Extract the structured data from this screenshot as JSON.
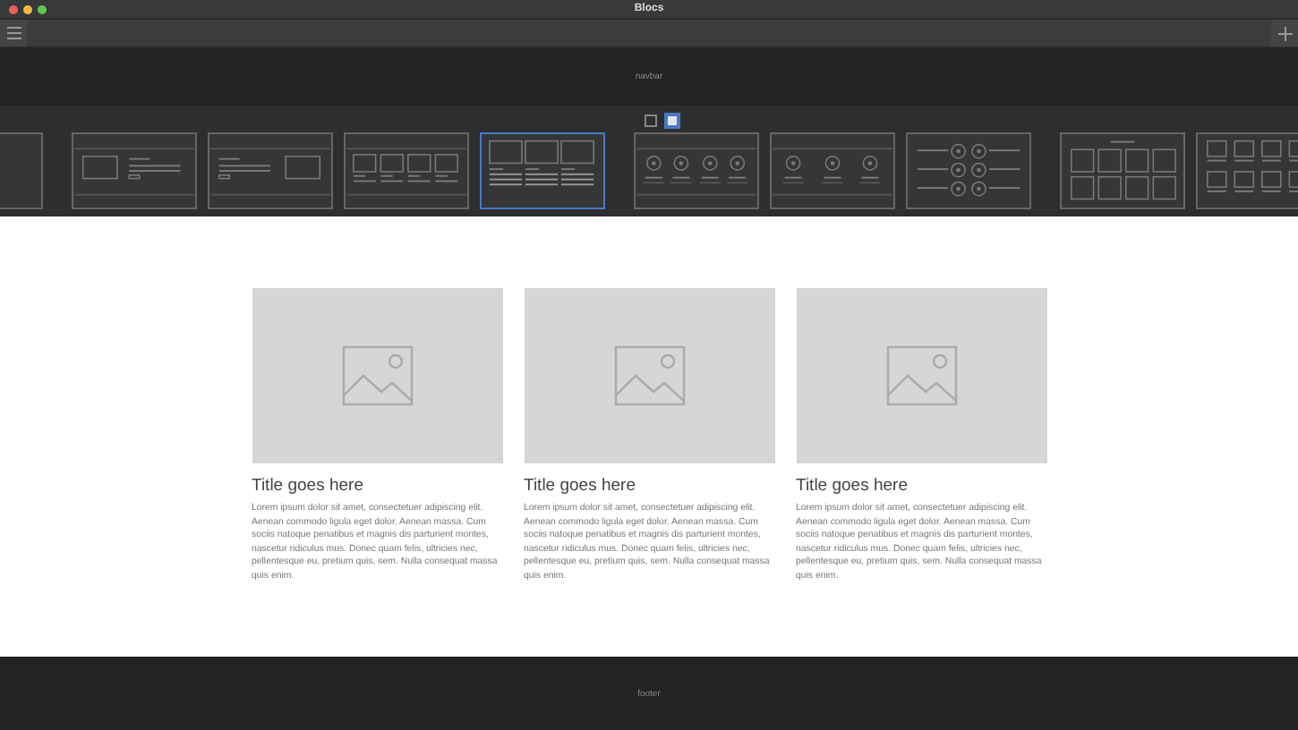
{
  "window": {
    "title": "Blocs"
  },
  "navbar": {
    "label": "navbar"
  },
  "view_toggles": [
    {
      "selected": false
    },
    {
      "selected": true
    }
  ],
  "block_groups": [
    {
      "thumbnails": [
        {
          "kind": "partial",
          "selected": false
        }
      ]
    },
    {
      "thumbnails": [
        {
          "kind": "hero-left",
          "selected": false
        },
        {
          "kind": "hero-right",
          "selected": false
        },
        {
          "kind": "four-cols",
          "selected": false
        },
        {
          "kind": "three-cards",
          "selected": true
        }
      ]
    },
    {
      "thumbnails": [
        {
          "kind": "four-icons",
          "selected": false
        },
        {
          "kind": "three-icons",
          "selected": false
        },
        {
          "kind": "icon-grid",
          "selected": false
        }
      ]
    },
    {
      "thumbnails": [
        {
          "kind": "grid-eight",
          "selected": false
        },
        {
          "kind": "card-grid",
          "selected": false
        }
      ]
    }
  ],
  "cards": [
    {
      "title": "Title goes here",
      "text": "Lorem ipsum dolor sit amet, consectetuer adipiscing elit. Aenean commodo ligula eget dolor. Aenean massa. Cum sociis natoque penatibus et magnis dis parturient montes, nascetur ridiculus mus. Donec quam felis, ultricies nec, pellentesque eu, pretium quis, sem. Nulla consequat massa quis enim."
    },
    {
      "title": "Title goes here",
      "text": "Lorem ipsum dolor sit amet, consectetuer adipiscing elit. Aenean commodo ligula eget dolor. Aenean massa. Cum sociis natoque penatibus et magnis dis parturient montes, nascetur ridiculus mus. Donec quam felis, ultricies nec, pellentesque eu, pretium quis, sem. Nulla consequat massa quis enim."
    },
    {
      "title": "Title goes here",
      "text": "Lorem ipsum dolor sit amet, consectetuer adipiscing elit. Aenean commodo ligula eget dolor. Aenean massa. Cum sociis natoque penatibus et magnis dis parturient montes, nascetur ridiculus mus. Donec quam felis, ultricies nec, pellentesque eu, pretium quis, sem. Nulla consequat massa quis enim."
    }
  ],
  "footer": {
    "label": "footer"
  }
}
